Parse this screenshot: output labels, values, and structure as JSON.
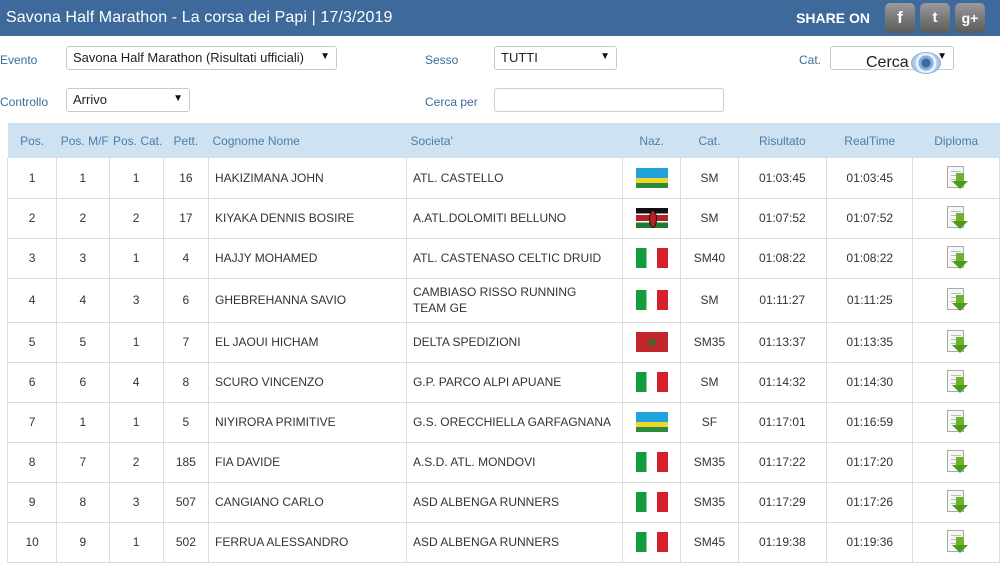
{
  "header": {
    "title": "Savona Half Marathon - La corsa dei Papi  |  17/3/2019",
    "share_label": "SHARE ON",
    "social": [
      "f",
      "t",
      "g+"
    ]
  },
  "filters": {
    "evento_label": "Evento",
    "evento_value": "Savona Half Marathon (Risultati ufficiali)",
    "sesso_label": "Sesso",
    "sesso_value": "TUTTI",
    "cat_label": "Cat.",
    "cat_value": "",
    "controllo_label": "Controllo",
    "controllo_value": "Arrivo",
    "cerca_per_label": "Cerca per",
    "cerca_per_value": "",
    "cerca_label": "Cerca"
  },
  "table": {
    "columns": [
      "Pos.",
      "Pos. M/F",
      "Pos. Cat.",
      "Pett.",
      "Cognome Nome",
      "Societa'",
      "Naz.",
      "Cat.",
      "Risultato",
      "RealTime",
      "Diploma"
    ],
    "rows": [
      {
        "pos": "1",
        "pos_mf": "1",
        "pos_cat": "1",
        "pett": "16",
        "name": "HAKIZIMANA JOHN",
        "societa": "ATL. CASTELLO",
        "naz": "RWA",
        "cat": "SM",
        "risultato": "01:03:45",
        "realtime": "01:03:45"
      },
      {
        "pos": "2",
        "pos_mf": "2",
        "pos_cat": "2",
        "pett": "17",
        "name": "KIYAKA DENNIS BOSIRE",
        "societa": "A.ATL.DOLOMITI BELLUNO",
        "naz": "KEN",
        "cat": "SM",
        "risultato": "01:07:52",
        "realtime": "01:07:52"
      },
      {
        "pos": "3",
        "pos_mf": "3",
        "pos_cat": "1",
        "pett": "4",
        "name": "HAJJY MOHAMED",
        "societa": "ATL. CASTENASO CELTIC DRUID",
        "naz": "ITA",
        "cat": "SM40",
        "risultato": "01:08:22",
        "realtime": "01:08:22"
      },
      {
        "pos": "4",
        "pos_mf": "4",
        "pos_cat": "3",
        "pett": "6",
        "name": "GHEBREHANNA SAVIO",
        "societa": "CAMBIASO RISSO RUNNING TEAM GE",
        "naz": "ITA",
        "cat": "SM",
        "risultato": "01:11:27",
        "realtime": "01:11:25"
      },
      {
        "pos": "5",
        "pos_mf": "5",
        "pos_cat": "1",
        "pett": "7",
        "name": "EL JAOUI HICHAM",
        "societa": "DELTA SPEDIZIONI",
        "naz": "MAR",
        "cat": "SM35",
        "risultato": "01:13:37",
        "realtime": "01:13:35"
      },
      {
        "pos": "6",
        "pos_mf": "6",
        "pos_cat": "4",
        "pett": "8",
        "name": "SCURO VINCENZO",
        "societa": "G.P. PARCO ALPI APUANE",
        "naz": "ITA",
        "cat": "SM",
        "risultato": "01:14:32",
        "realtime": "01:14:30"
      },
      {
        "pos": "7",
        "pos_mf": "1",
        "pos_cat": "1",
        "pett": "5",
        "name": "NIYIRORA PRIMITIVE",
        "societa": "G.S. ORECCHIELLA GARFAGNANA",
        "naz": "RWA",
        "cat": "SF",
        "risultato": "01:17:01",
        "realtime": "01:16:59"
      },
      {
        "pos": "8",
        "pos_mf": "7",
        "pos_cat": "2",
        "pett": "185",
        "name": "FIA DAVIDE",
        "societa": "A.S.D. ATL. MONDOVI",
        "naz": "ITA",
        "cat": "SM35",
        "risultato": "01:17:22",
        "realtime": "01:17:20"
      },
      {
        "pos": "9",
        "pos_mf": "8",
        "pos_cat": "3",
        "pett": "507",
        "name": "CANGIANO CARLO",
        "societa": "ASD ALBENGA RUNNERS",
        "naz": "ITA",
        "cat": "SM35",
        "risultato": "01:17:29",
        "realtime": "01:17:26"
      },
      {
        "pos": "10",
        "pos_mf": "9",
        "pos_cat": "1",
        "pett": "502",
        "name": "FERRUA ALESSANDRO",
        "societa": "ASD ALBENGA RUNNERS",
        "naz": "ITA",
        "cat": "SM45",
        "risultato": "01:19:38",
        "realtime": "01:19:36"
      }
    ]
  }
}
